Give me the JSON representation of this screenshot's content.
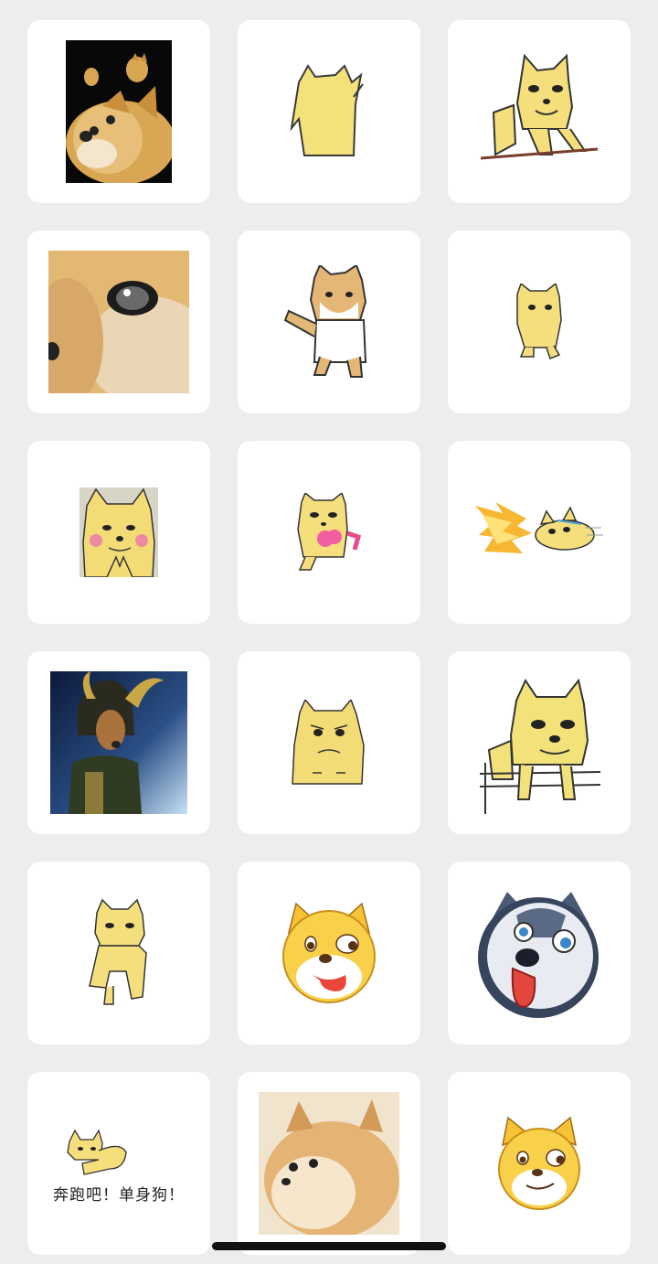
{
  "stickers": [
    {
      "icon": "doge-photo-sticker"
    },
    {
      "icon": "doge-back-sticker"
    },
    {
      "icon": "doge-at-table-sticker"
    },
    {
      "icon": "doge-eye-closeup-sticker"
    },
    {
      "icon": "shiba-dancing-sticker"
    },
    {
      "icon": "doge-small-walking-sticker"
    },
    {
      "icon": "doge-blushing-sticker"
    },
    {
      "icon": "doge-with-heart-sticker"
    },
    {
      "icon": "doge-fire-dash-sticker"
    },
    {
      "icon": "loki-doge-sticker"
    },
    {
      "icon": "doge-angry-sticker"
    },
    {
      "icon": "doge-leaning-fence-sticker"
    },
    {
      "icon": "doge-standing-sticker"
    },
    {
      "icon": "doge-tongue-emoji-sticker"
    },
    {
      "icon": "husky-tongue-emoji-sticker"
    },
    {
      "icon": "doge-running-caption-sticker",
      "caption": "奔跑吧！单身狗！"
    },
    {
      "icon": "doge-fluffy-photo-sticker"
    },
    {
      "icon": "doge-smirk-emoji-sticker"
    }
  ],
  "colors": {
    "background": "#ededed",
    "tile": "#ffffff",
    "doge_yellow": "#f3dc76",
    "doge_photo": "#d9a653"
  }
}
